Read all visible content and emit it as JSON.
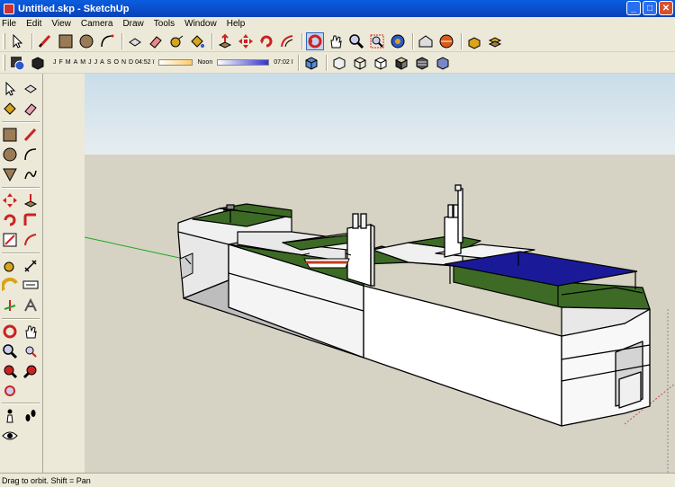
{
  "window": {
    "title": "Untitled.skp - SketchUp"
  },
  "menu": [
    "File",
    "Edit",
    "View",
    "Camera",
    "Draw",
    "Tools",
    "Window",
    "Help"
  ],
  "shadow_toolbar": {
    "months": [
      "J",
      "F",
      "M",
      "A",
      "M",
      "J",
      "J",
      "A",
      "S",
      "O",
      "N",
      "D"
    ],
    "time_start": "04:52 ï",
    "noon": "Noon",
    "time_end": "07:02 ï"
  },
  "status": {
    "text": "Drag to orbit.  Shift = Pan"
  },
  "colors": {
    "sky": "#dde9f0",
    "ground": "#d6d3c4",
    "deck": "#3d6b25",
    "hull": "#ffffff",
    "solar": "#1a1a99"
  }
}
